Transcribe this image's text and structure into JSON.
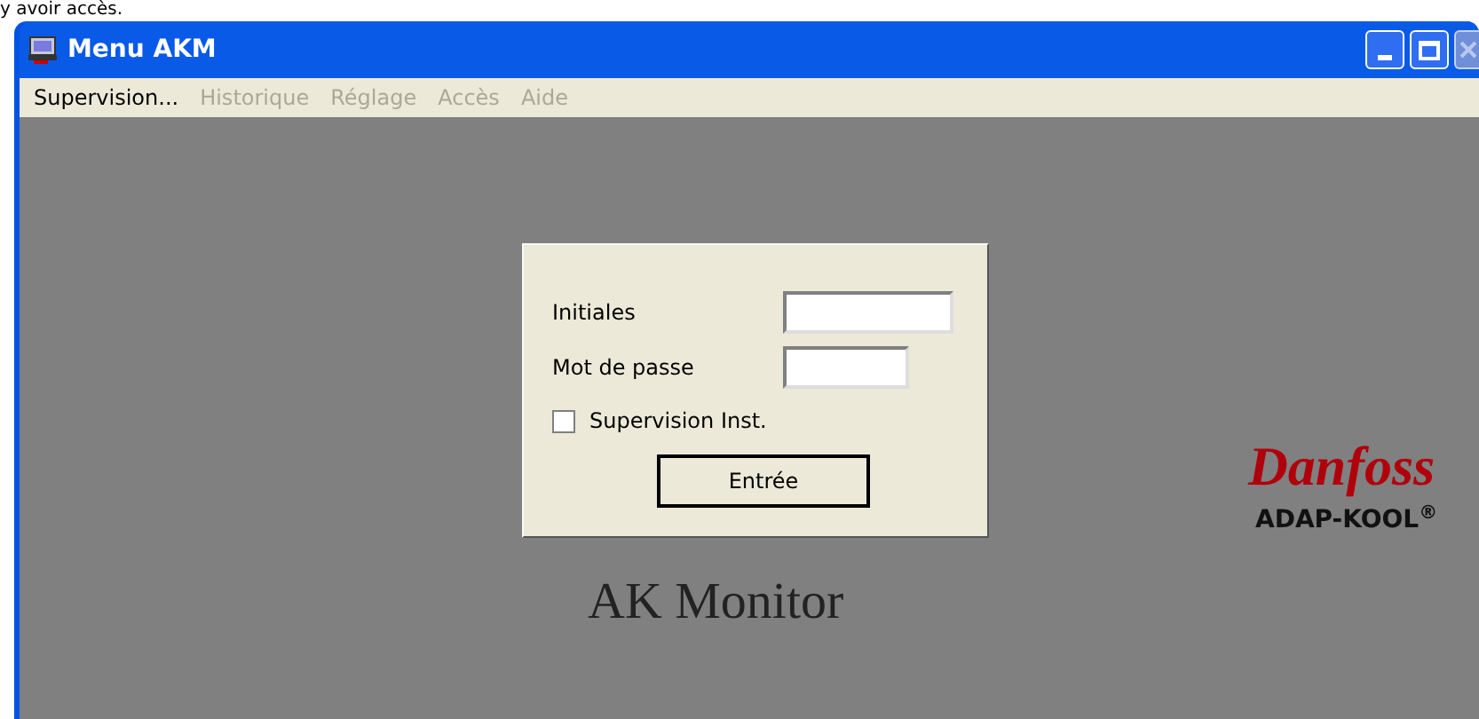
{
  "caption": "y avoir accès.",
  "window": {
    "title": "Menu AKM",
    "close_disabled": true
  },
  "menu": [
    {
      "label": "Supervision...",
      "disabled": false
    },
    {
      "label": "Historique",
      "disabled": true
    },
    {
      "label": "Réglage",
      "disabled": true
    },
    {
      "label": "Accès",
      "disabled": true
    },
    {
      "label": "Aide",
      "disabled": true
    }
  ],
  "login": {
    "fields": [
      {
        "label": "Initiales",
        "wide": true
      },
      {
        "label": "Mot de passe",
        "wide": false
      }
    ],
    "checkbox": {
      "label": "Supervision Inst.",
      "checked": false
    },
    "button": "Entrée"
  },
  "app_title": "AK Monitor",
  "logo": {
    "brand": "Danfoss",
    "product": "ADAP-KOOL$^{®}$"
  }
}
